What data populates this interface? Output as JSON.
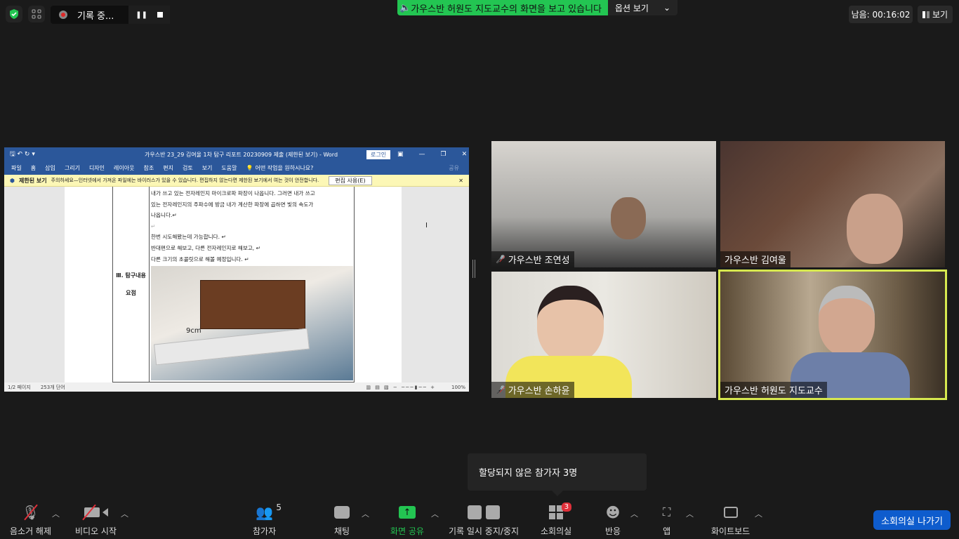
{
  "top": {
    "recording_label": "기록 중...",
    "banner": "가우스반 허원도 지도교수의 화면을 보고 있습니다",
    "options": "옵션 보기",
    "timer": "남음: 00:16:02",
    "view": "보기"
  },
  "word": {
    "title": "가우스반 23_29 김여울  1차 탐구 리포트 20230909 제출 (제한된 보기) - Word",
    "login": "로그인",
    "ribbon": [
      "파일",
      "홈",
      "삽입",
      "그리기",
      "디자인",
      "레이아웃",
      "참조",
      "편지",
      "검토",
      "보기",
      "도움말"
    ],
    "tell_me": "어떤 작업을 원하시나요?",
    "share": "공유",
    "warn_title": "제한된 보기",
    "warn_text": "주의하세요—인터넷에서 가져온 파일에는 바이러스가 있을 수 있습니다. 편집하지 않는다면 제한된 보기에서 여는 것이 안전합니다.",
    "enable_edit": "편집 사용(E)",
    "section_label": "Ⅲ. 탐구내용",
    "section_label2": "요점",
    "lines": [
      "내가 쓰고 있는 전자레인지 마이크로파 파장이 나옵니다. 그러면 내가 쓰고",
      "있는 전자레인지의 주파수에 방금 내가 계산한 파장에 곱하면 빛의 속도가",
      "나옵니다.↵",
      "↵",
      "한번 시도해봤는데 가능합니다. ↵",
      "반대편으로 해보고, 다른 전자레인지로 해보고, ↵",
      "다른 크기의 초콜릿으로 해볼 예정입니다. ↵"
    ],
    "photo_label": "9cm",
    "status_page": "1/2 페이지",
    "status_words": "253개 단어",
    "zoom": "100%"
  },
  "participants": [
    {
      "name": "가우스반 조연성",
      "muted": true
    },
    {
      "name": "가우스반 김여울",
      "muted": false
    },
    {
      "name": "가우스반 손하윤",
      "muted": true
    },
    {
      "name": "가우스반 허원도 지도교수",
      "muted": false,
      "active": true
    }
  ],
  "tooltip": "할당되지 않은 참가자 3명",
  "toolbar": {
    "unmute": "음소거 해제",
    "video": "비디오 시작",
    "participants": "참가자",
    "participants_count": "5",
    "chat": "채팅",
    "share": "화면 공유",
    "record": "기록 일시 중지/중지",
    "breakout": "소회의실",
    "breakout_badge": "3",
    "reactions": "반응",
    "apps": "앱",
    "whiteboard": "화이트보드",
    "leave_breakout": "소회의실 나가기"
  }
}
